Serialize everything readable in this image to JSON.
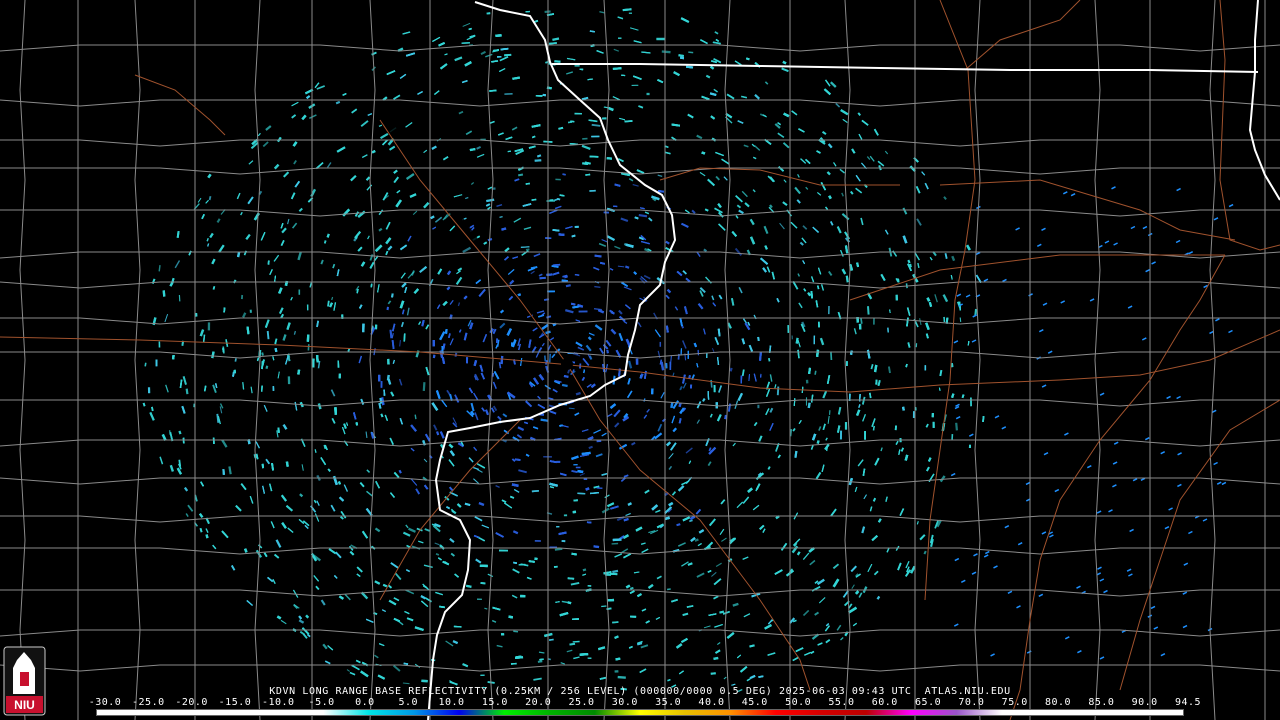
{
  "product": {
    "caption": "KDVN LONG RANGE BASE REFLECTIVITY (0.25KM / 256 LEVEL) (000000/0000 0.5 DEG) 2025-06-03 09:43 UTC  ATLAS.NIU.EDU"
  },
  "logo": {
    "text": "NIU",
    "colors": {
      "red": "#c8102e",
      "white": "#ffffff"
    }
  },
  "colorbar": {
    "ticks": [
      "-30.0",
      "-25.0",
      "-20.0",
      "-15.0",
      "-10.0",
      "-5.0",
      "0.0",
      "5.0",
      "10.0",
      "15.0",
      "20.0",
      "25.0",
      "30.0",
      "35.0",
      "40.0",
      "45.0",
      "50.0",
      "55.0",
      "60.0",
      "65.0",
      "70.0",
      "75.0",
      "80.0",
      "85.0",
      "90.0",
      "94.5"
    ],
    "colors": [
      "#ffffff",
      "#ffffff",
      "#ffffff",
      "#ffffff",
      "#ffffff",
      "#ffffff",
      "#00e5e5",
      "#0099e6",
      "#0000f0",
      "#00ee00",
      "#00b300",
      "#008a00",
      "#ffff00",
      "#e6c000",
      "#ff9100",
      "#ff0000",
      "#d40000",
      "#bb0000",
      "#ff00ff",
      "#9955c9",
      "#ffffff",
      "#ffffff",
      "#ffffff",
      "#ffffff",
      "#ffffff"
    ]
  },
  "map_colors": {
    "background": "#000000",
    "state_boundary": "#ffffff",
    "county_boundary": "#8a8a8a",
    "highway": "#a0522d",
    "echo_cyan": "#33d6d6",
    "echo_blue": "#1e90ff",
    "echo_deep": "#2a5fe0"
  }
}
